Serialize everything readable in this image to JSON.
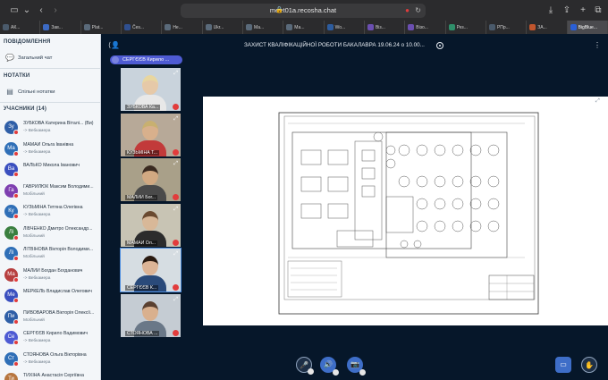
{
  "browser": {
    "url": "meet01a.recosha.chat",
    "tabs": [
      {
        "label": "АК...",
        "color": "#4a5a6b"
      },
      {
        "label": "Зав...",
        "color": "#3c6ac4"
      },
      {
        "label": "Plat...",
        "color": "#5a6a7a"
      },
      {
        "label": "Čes...",
        "color": "#2f4f8f"
      },
      {
        "label": "Не...",
        "color": "#5a6a7a"
      },
      {
        "label": "Ukr...",
        "color": "#5a6a7a"
      },
      {
        "label": "Ма...",
        "color": "#5a6a7a"
      },
      {
        "label": "Ма...",
        "color": "#5a6a7a"
      },
      {
        "label": "Wo...",
        "color": "#2d5c9e"
      },
      {
        "label": "Віз...",
        "color": "#6b4fb1"
      },
      {
        "label": "Візо...",
        "color": "#6b4fb1"
      },
      {
        "label": "Рез...",
        "color": "#2f8f6a"
      },
      {
        "label": "РПр...",
        "color": "#4a5a6b"
      },
      {
        "label": "ЗА...",
        "color": "#c1552d"
      },
      {
        "label": "BigBlue...",
        "color": "#2a5fd6"
      }
    ]
  },
  "sidebar": {
    "messages_header": "ПОВІДОМЛЕННЯ",
    "public_chat": "Загальний чат",
    "notes_header": "НОТАТКИ",
    "shared_notes": "Спільні нотатки",
    "users_header": "УЧАСНИКИ (14)",
    "users": [
      {
        "initials": "Зу",
        "name": "ЗУБКОВА Катерина Віталі... (Ви)",
        "sub": "-> Вебкамера",
        "color": "#2f5fa7"
      },
      {
        "initials": "Ма",
        "name": "МАМАЙ Ольга Іванівна",
        "sub": "-> Вебкамера",
        "color": "#2f6fb7"
      },
      {
        "initials": "Ва",
        "name": "ВАЛЬКО Микола Іванович",
        "sub": "",
        "color": "#3a4fbf"
      },
      {
        "initials": "Га",
        "name": "ГАВРИЛЮК Максим Володими...",
        "sub": "Мобільний",
        "color": "#7e3fb0"
      },
      {
        "initials": "Ку",
        "name": "КУЗЬМІНА Тетяна Олегівна",
        "sub": "-> Вебкамера",
        "color": "#2f6fb7"
      },
      {
        "initials": "Лі",
        "name": "ЛІБЧЕНКО Дмитро Олександр...",
        "sub": "Мобільний",
        "color": "#3a7f3f"
      },
      {
        "initials": "Лі",
        "name": "ЛІТВІНОВА Вікторія Володими...",
        "sub": "Мобільний",
        "color": "#2f6fb7"
      },
      {
        "initials": "Ма",
        "name": "МАЛИЙ Богдан Богданович",
        "sub": "-> Вебкамера",
        "color": "#b73f3f"
      },
      {
        "initials": "Ме",
        "name": "МЕРКЕЛЬ Владислав Олегович",
        "sub": "",
        "color": "#3a4fbf"
      },
      {
        "initials": "Пи",
        "name": "ПИВОВАРОВА Вікторія Олексії...",
        "sub": "Мобільний",
        "color": "#2f5fa7"
      },
      {
        "initials": "Се",
        "name": "СЕРГЄЄВ Кирило Вадимович",
        "sub": "-> Вебкамера",
        "color": "#4e5bd3"
      },
      {
        "initials": "Ст",
        "name": "СТОЯНОВА Ольга Вікторівна",
        "sub": "-> Вебкамера",
        "color": "#2f6fb7"
      },
      {
        "initials": "Ти",
        "name": "ТИХІНА Анастасія Сергіївна",
        "sub": "",
        "color": "#b7763f"
      }
    ]
  },
  "meeting": {
    "title": "ЗАХИСТ КВАЛІФІКАЦІЙНОЇ РОБОТИ БАКАЛАВРА 19.06.24 о 10.00...",
    "presenter": "СЕРГЄЄВ Кирило ...",
    "videos": [
      {
        "label": "ЗУБКОВА Ка..."
      },
      {
        "label": "КУЗЬМІНА Т..."
      },
      {
        "label": "МАЛИЙ Бог..."
      },
      {
        "label": "МАМАЙ Ол..."
      },
      {
        "label": "СЕРГЄЄВ К..."
      },
      {
        "label": "СТОЯНОВА ..."
      }
    ]
  }
}
